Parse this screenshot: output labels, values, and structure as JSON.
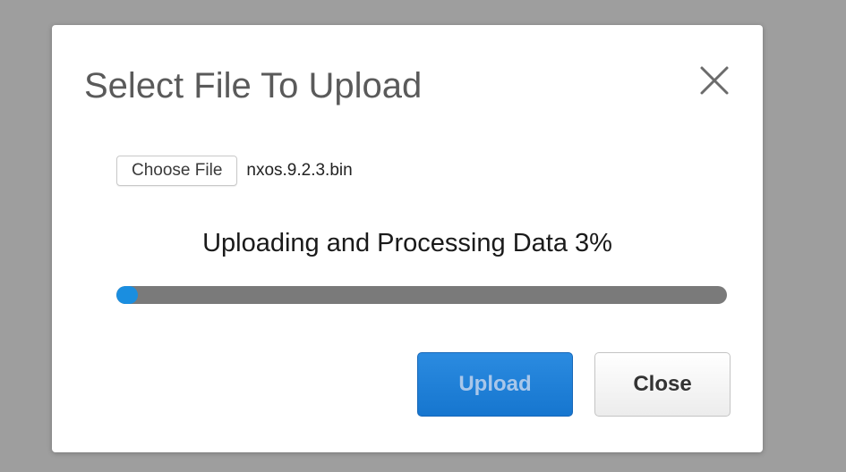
{
  "dialog": {
    "title": "Select File To Upload",
    "close_icon": "close-x-icon"
  },
  "file_picker": {
    "choose_label": "Choose File",
    "file_name": "nxos.9.2.3.bin"
  },
  "progress": {
    "status_text": "Uploading and Processing Data 3%",
    "percent": 3
  },
  "buttons": {
    "upload_label": "Upload",
    "close_label": "Close"
  },
  "colors": {
    "accent": "#1a8ee0",
    "backdrop": "#9e9e9e",
    "track": "#7a7a7a"
  }
}
